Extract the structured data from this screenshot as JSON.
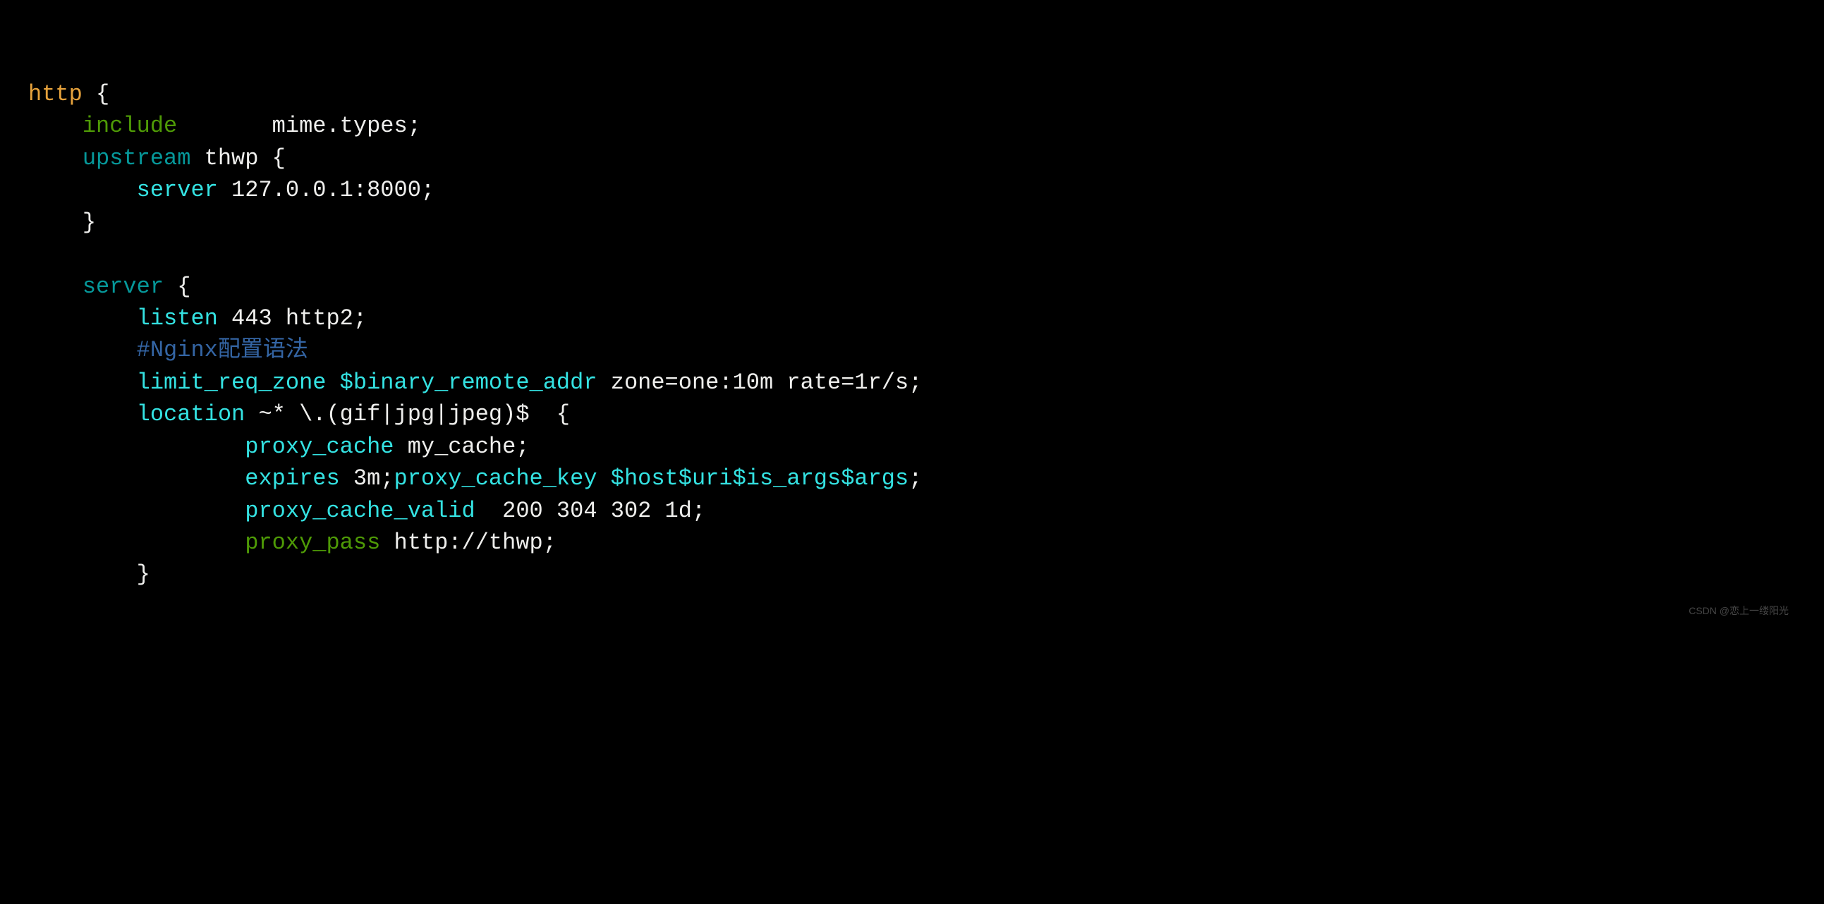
{
  "watermark": "CSDN @恋上一缕阳光",
  "code": {
    "allproxy": "proxy_pass",
    "l1": {
      "t1": "http",
      "t2": " {"
    },
    "l2": {
      "indent": "    ",
      "t1": "include",
      "t2": "       mime.types;"
    },
    "l3": {
      "indent": "    ",
      "t1": "upstream",
      "t2": " thwp {"
    },
    "l4": {
      "indent": "        ",
      "t1": "server",
      "t2": " 127.0.0.1:8000;"
    },
    "l5": {
      "indent": "    ",
      "t1": "}"
    },
    "l6": {
      "t1": ""
    },
    "l7": {
      "indent": "    ",
      "t1": "server",
      "t2": " {"
    },
    "l8": {
      "indent": "        ",
      "t1": "listen",
      "t2": " 443 http2;"
    },
    "l9": {
      "indent": "        ",
      "t1": "#Nginx配置语法"
    },
    "l10": {
      "indent": "        ",
      "t1": "limit_req_zone $binary_remote_addr",
      "t2": " zone=one:10m rate=1r/s;"
    },
    "l11": {
      "indent": "        ",
      "t1": "location",
      "t2": " ~* \\.(gif|jpg|jpeg)$  {"
    },
    "l12": {
      "indent": "                ",
      "t1": "proxy_cache",
      "t2": " my_cache;"
    },
    "l13": {
      "indent": "                ",
      "t1": "expires",
      "t2": " 3m;",
      "t3": "proxy_cache_key $host$uri$is_args$args",
      "t4": ";"
    },
    "l14": {
      "indent": "                ",
      "t1": "proxy_cache_valid",
      "t2": "  200 304 302 1d;"
    },
    "l15": {
      "indent": "                ",
      "t2": " http://thwp;"
    },
    "l16": {
      "indent": "        ",
      "t1": "}"
    }
  }
}
